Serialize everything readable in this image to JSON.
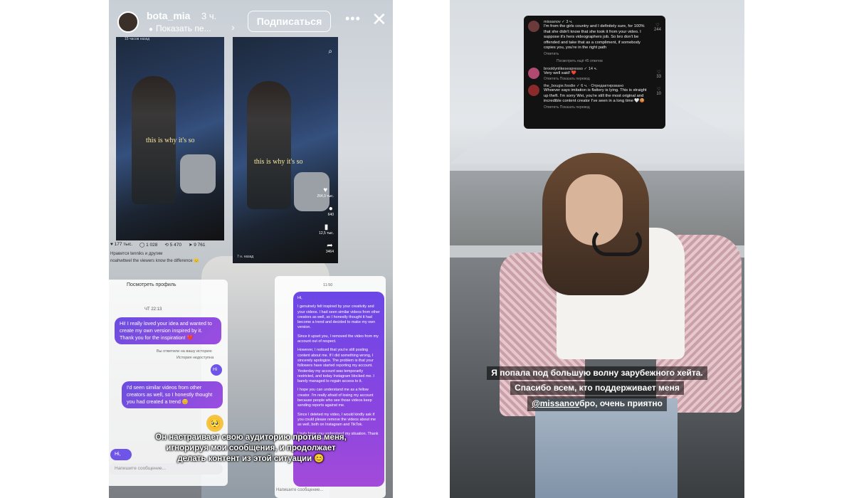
{
  "left_story": {
    "username": "bota_mia",
    "time": "3 ч.",
    "show_more": "Показать пе...",
    "subscribe_label": "Подписаться",
    "tiktok1": {
      "timestamp": "15 часов назад",
      "caption": "this is why it's so",
      "stats": [
        "177 тыс.",
        "1 028",
        "5 470",
        "9 761"
      ],
      "likes_line": "Нравится tenniks и другим",
      "desc_line": "noahwttwel the viewers know the difference 😊"
    },
    "tiktok2": {
      "caption": "this is why it's so",
      "counts": [
        "264,3 тыс.",
        "640",
        "12,5 тыс.",
        "3464"
      ],
      "bottom": "7 н. назад"
    },
    "chat_left": {
      "view_profile": "Посмотреть профиль",
      "date": "ЧТ 22:13",
      "msg1": "Hi! I really loved your idea and wanted to create my own version inspired by it. Thank you for the inspiration! ❤️",
      "meta1": "Вы ответили на вашу историю",
      "meta2": "История недоступна",
      "msg_hi_small": "Hi",
      "msg2": "I'd seen similar videos from other creators as well, so I honestly thought you had created a trend 😊",
      "msg_hi": "Hi,",
      "input_placeholder": "Напишите сообщение..."
    },
    "chat_right": {
      "time": "11:50",
      "paragraphs": [
        "Hi,",
        "I genuinely felt inspired by your creativity and your videos. I had seen similar videos from other creators as well, so I honestly thought it had become a trend and decided to make my own version.",
        "Since it upset you, I removed the video from my account out of respect.",
        "However, I noticed that you're still posting content about me. If I did something wrong, I sincerely apologize. The problem is that your followers have started reporting my account. Yesterday my account was temporarily restricted, and today Instagram blocked me. I barely managed to regain access to it.",
        "I hope you can understand me as a fellow creator. I'm really afraid of losing my account because people who see those videos keep sending reports against me.",
        "Since I deleted my video, I would kindly ask if you could please remove the videos about me as well, both on Instagram and TikTok.",
        "I truly hope you understand my situation. Thank you for your understanding."
      ],
      "input_placeholder": "Напишите сообщение..."
    },
    "caption": [
      "Он настраивает свою аудиторию против меня,",
      "игнорируя мои сообщения, и продолжает",
      "делать контент из этой ситуации 😊"
    ]
  },
  "right_story": {
    "comments": [
      {
        "name": "missanov ✓ 3 ч.",
        "text": "I'm from the girls country and I definitely sure, for 100% that she didn't know that she took it from your video. I suppose it's hers videographers job. So bro don't be offended and take that as a compliment, if somebody copies you, you're in the right path",
        "actions": "Ответить",
        "likes": "244",
        "avatar_color": "#6b3a3a"
      },
      {
        "name": "brooklynlikesespresso ✓ 14 ч.",
        "text": "Very well said! ❤️",
        "actions": "Ответить   Показать перевод",
        "likes": "33",
        "avatar_color": "#b04a70"
      },
      {
        "name": "the_bougie.foodie ✓ 6 ч. · Отредактировано",
        "text": "Whoever says imitation is flattery is lying. This is straight up theft. I'm sorry Wei, you're still the most original and incredible content creator I've seen in a long time 🤍🍪",
        "actions": "Ответить   Показать перевод",
        "likes": "10",
        "avatar_color": "#8a2a2a"
      }
    ],
    "more_replies": "Посмотреть ещё 45 ответов",
    "caption": {
      "line1": "Я попала под большую волну зарубежного хейта.",
      "line2": "Спасибо всем, кто поддерживает меня",
      "mention": "@missanov",
      "line3_rest": " бро, очень приятно"
    }
  }
}
